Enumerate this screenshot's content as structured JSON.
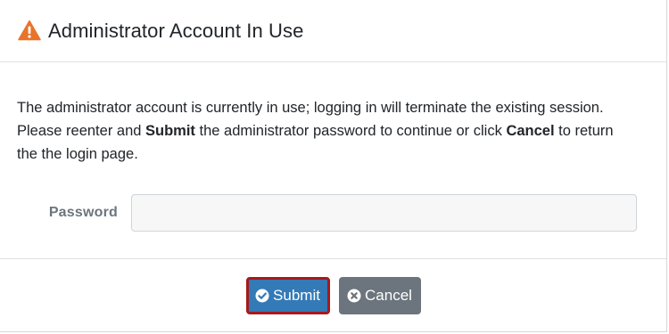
{
  "dialog": {
    "title": "Administrator Account In Use",
    "title_icon": "warning-triangle-icon",
    "message": {
      "line1": "The administrator account is currently in use; logging in will terminate the existing session.",
      "line2_pre": "Please reenter and ",
      "line2_submit": "Submit",
      "line2_mid": " the administrator password to continue or click ",
      "line2_cancel": "Cancel",
      "line2_post": " to return",
      "line3": "the the login page."
    },
    "password": {
      "label": "Password",
      "value": "",
      "placeholder": ""
    },
    "buttons": {
      "submit_label": "Submit",
      "submit_icon": "check-circle-icon",
      "cancel_label": "Cancel",
      "cancel_icon": "times-circle-icon"
    },
    "colors": {
      "warning": "#e8742a",
      "submit_bg": "#337ab7",
      "submit_focus_border": "#a51a1a",
      "cancel_bg": "#6c757d"
    }
  }
}
